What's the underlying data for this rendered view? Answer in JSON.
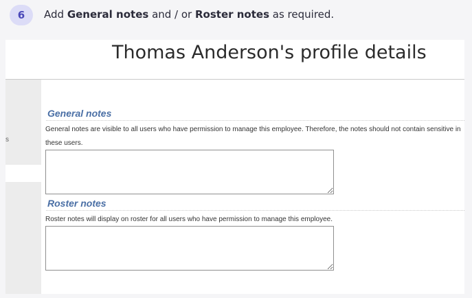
{
  "step": {
    "number": "6"
  },
  "instruction": {
    "prefix": "Add ",
    "bold1": "General notes",
    "middle": " and / or ",
    "bold2": "Roster notes",
    "suffix": " as required."
  },
  "profile": {
    "title": "Thomas Anderson's profile details"
  },
  "sidebar": {
    "partial_text": "s"
  },
  "general_notes": {
    "heading": "General notes",
    "description_line1": "General notes are visible to all users who have permission to manage this employee. Therefore, the notes should not contain sensitive in",
    "description_line2": "these users.",
    "value": ""
  },
  "roster_notes": {
    "heading": "Roster notes",
    "description": "Roster notes will display on roster for all users who have permission to manage this employee.",
    "value": ""
  }
}
